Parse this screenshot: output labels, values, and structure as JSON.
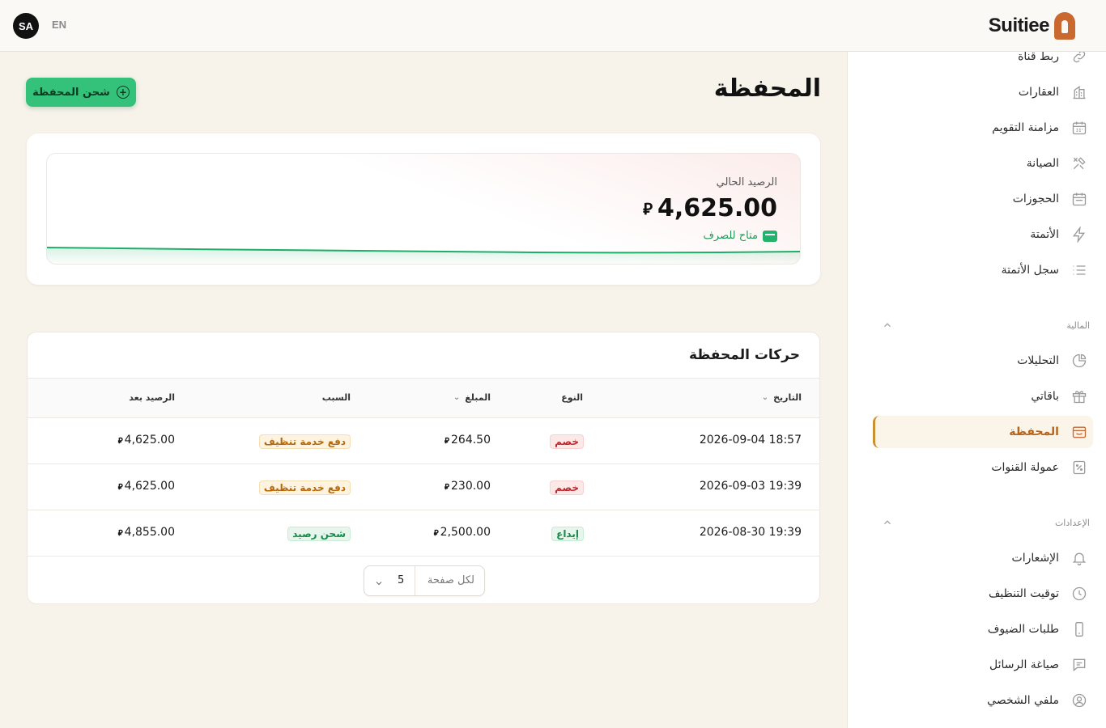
{
  "header": {
    "avatar_initials": "SA",
    "language_toggle": "EN",
    "brand_name": "Suitiee"
  },
  "sidebar": {
    "items_top": [
      {
        "label": "ربط قناة",
        "icon": "link-icon"
      },
      {
        "label": "العقارات",
        "icon": "building-icon"
      },
      {
        "label": "مزامنة التقويم",
        "icon": "calendar-sync-icon"
      },
      {
        "label": "الصيانة",
        "icon": "tools-icon"
      },
      {
        "label": "الحجوزات",
        "icon": "calendar-icon"
      },
      {
        "label": "الأتمتة",
        "icon": "lightning-icon"
      },
      {
        "label": "سجل الأتمتة",
        "icon": "list-icon"
      }
    ],
    "finance_section": {
      "title": "المالية",
      "items": [
        {
          "label": "التحليلات",
          "icon": "pie-chart-icon"
        },
        {
          "label": "باقاتي",
          "icon": "gift-icon"
        },
        {
          "label": "المحفظة",
          "icon": "wallet-icon",
          "active": true
        },
        {
          "label": "عمولة القنوات",
          "icon": "percent-icon"
        }
      ]
    },
    "settings_section": {
      "title": "الإعدادات",
      "items": [
        {
          "label": "الإشعارات",
          "icon": "bell-icon"
        },
        {
          "label": "توقيت التنظيف",
          "icon": "clock-icon"
        },
        {
          "label": "طلبات الضيوف",
          "icon": "phone-icon"
        },
        {
          "label": "صياغة الرسائل",
          "icon": "message-icon"
        },
        {
          "label": "ملفي الشخصي",
          "icon": "user-circle-icon"
        }
      ]
    }
  },
  "main": {
    "title": "المحفظة",
    "topup_button": "شحن المحفظة",
    "balance": {
      "label": "الرصيد الحالي",
      "amount": "4,625.00",
      "currency_symbol": "⃁",
      "available_text": "متاح للصرف"
    },
    "transactions": {
      "title": "حركات المحفظة",
      "columns": {
        "date": "التاريخ",
        "type": "النوع",
        "amount": "المبلغ",
        "reason": "السبب",
        "balance_after": "الرصيد بعد"
      },
      "rows": [
        {
          "date": "2026-09-04 18:57",
          "type": "خصم",
          "type_kind": "deduct",
          "amount": "264.50",
          "reason": "دفع خدمة تنظيف",
          "reason_kind": "clean",
          "balance_after": "4,625.00"
        },
        {
          "date": "2026-09-03 19:39",
          "type": "خصم",
          "type_kind": "deduct",
          "amount": "230.00",
          "reason": "دفع خدمة تنظيف",
          "reason_kind": "clean",
          "balance_after": "4,625.00"
        },
        {
          "date": "2026-08-30 19:39",
          "type": "إيداع",
          "type_kind": "deposit",
          "amount": "2,500.00",
          "reason": "شحن رصيد",
          "reason_kind": "topup",
          "balance_after": "4,855.00"
        }
      ],
      "per_page_label": "لكل صفحة",
      "per_page_value": "5"
    }
  },
  "colors": {
    "accent_green": "#34c27a",
    "active_nav": "#c9912f",
    "deduct_red": "#c0262d",
    "deposit_green": "#1a8a4c"
  }
}
